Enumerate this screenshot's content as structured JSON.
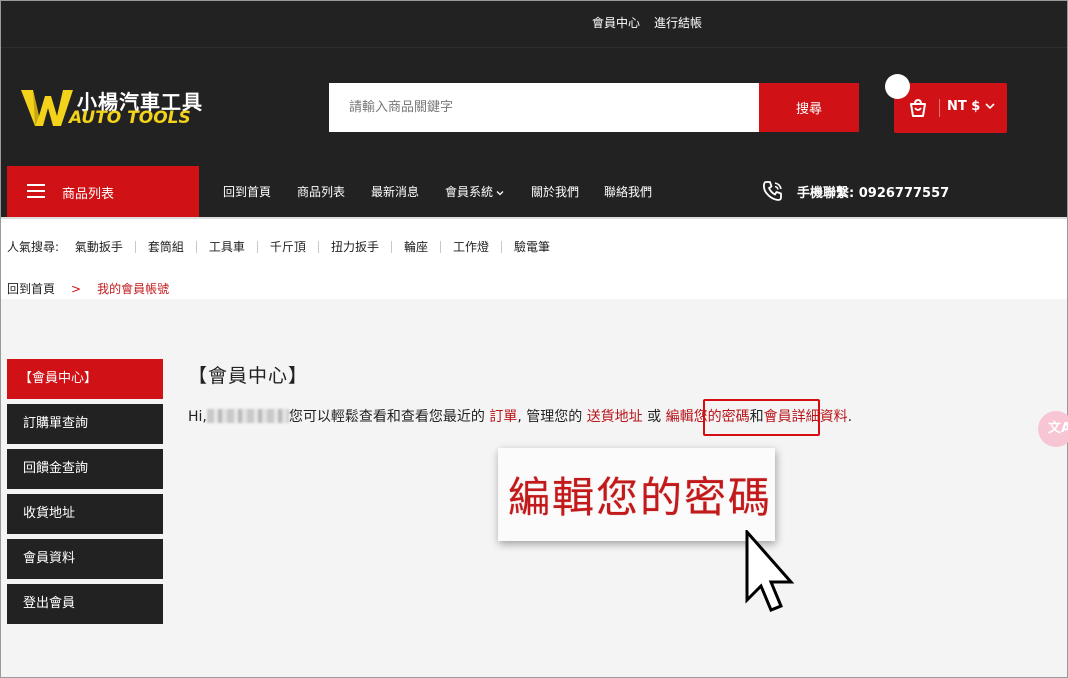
{
  "topbar": {
    "member_center": "會員中心",
    "checkout": "進行結帳"
  },
  "logo": {
    "zh": "小楊汽車工具",
    "en": "AUTO TOOLS"
  },
  "search": {
    "placeholder": "請輸入商品關鍵字",
    "button": "搜尋"
  },
  "cart": {
    "currency": "NT $"
  },
  "nav": {
    "categories": "商品列表",
    "items": [
      "回到首頁",
      "商品列表",
      "最新消息",
      "會員系統",
      "關於我們",
      "聯絡我們"
    ],
    "phone": "手機聯繫: 0926777557"
  },
  "popular": {
    "label": "人氣搜尋:",
    "keywords": [
      "氣動扳手",
      "套筒組",
      "工具車",
      "千斤頂",
      "扭力扳手",
      "輪座",
      "工作燈",
      "驗電筆"
    ]
  },
  "breadcrumb": {
    "home": "回到首頁",
    "sep": ">",
    "current": "我的會員帳號"
  },
  "sidebar": {
    "items": [
      "【會員中心】",
      "訂購單查詢",
      "回饋金查詢",
      "收貨地址",
      "會員資料",
      "登出會員"
    ]
  },
  "main": {
    "title": "【會員中心】",
    "hi": "Hi,",
    "text1": "您可以輕鬆查看和查看您最近的",
    "orders_link": "訂單",
    "text2": ", 管理您的",
    "address_link": "送貨地址",
    "text3": "或",
    "password_link": "編輯您的密碼",
    "text4": "和",
    "details_link": "會員詳細資料",
    "text5": "."
  },
  "zoom": {
    "text": "編輯您的密碼"
  },
  "translate": {
    "label": "文A"
  },
  "colors": {
    "accent": "#d01216",
    "dark": "#222222",
    "link": "#b8161b"
  }
}
